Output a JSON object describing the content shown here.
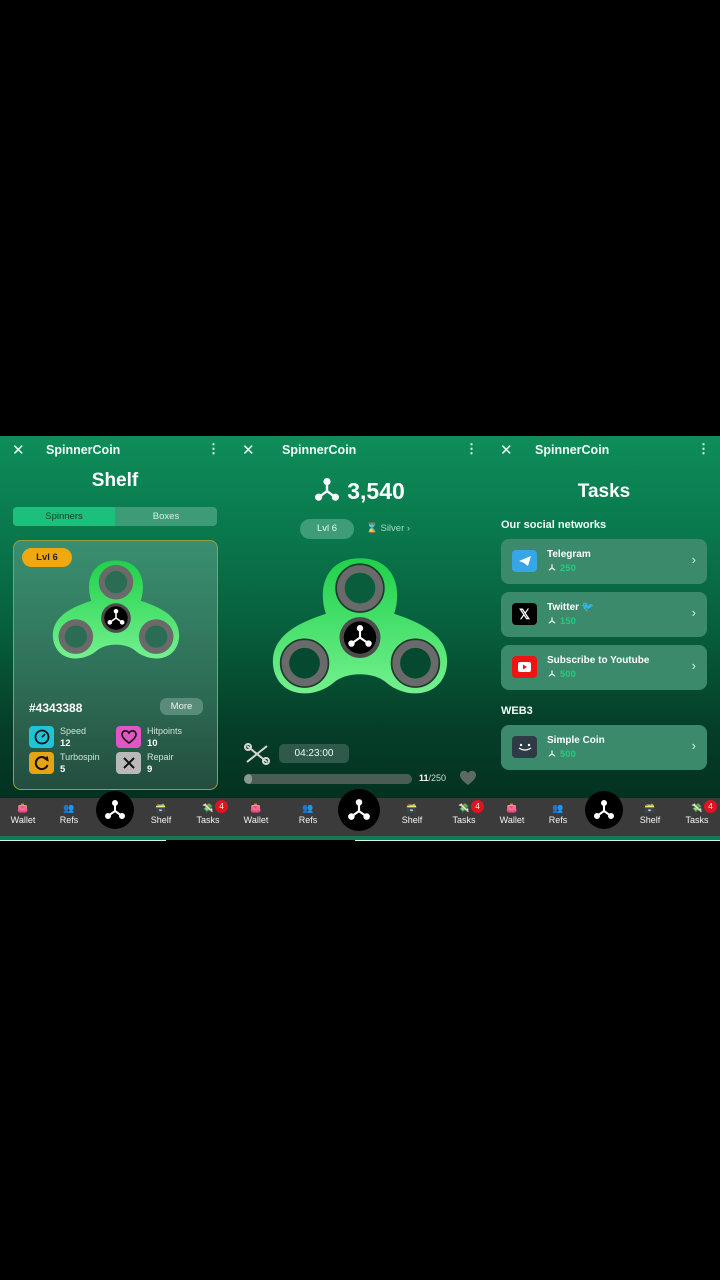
{
  "app": {
    "title": "SpinnerCoin",
    "close_icon": "close-icon",
    "menu_icon": "more-vertical-icon"
  },
  "shelf": {
    "title": "Shelf",
    "tabs": [
      {
        "label": "Spinners",
        "active": true
      },
      {
        "label": "Boxes",
        "active": false
      }
    ],
    "card": {
      "level": "Lvl 6",
      "id": "#4343388",
      "more_label": "More",
      "stats": [
        {
          "name": "Speed",
          "value": "12",
          "icon": "speedometer-icon",
          "color": "#1fc4d8"
        },
        {
          "name": "Hitpoints",
          "value": "10",
          "icon": "heart-icon",
          "color": "#e056c4"
        },
        {
          "name": "Turbospin",
          "value": "5",
          "icon": "refresh-icon",
          "color": "#e6a312"
        },
        {
          "name": "Repair",
          "value": "9",
          "icon": "tools-icon",
          "color": "#b9b9b9"
        }
      ]
    }
  },
  "home": {
    "balance": "3,540",
    "level": "Lvl 6",
    "league": "Silver",
    "league_chevron": "›",
    "repair_timer": "04:23:00",
    "hitpoints_current": "11",
    "hitpoints_max": "/250",
    "hitpoints_progress": 0.044
  },
  "tasks": {
    "title": "Tasks",
    "sections": [
      {
        "title": "Our social networks",
        "items": [
          {
            "name": "Telegram",
            "reward": "250",
            "icon": "telegram-icon"
          },
          {
            "name": "Twitter 🐦",
            "reward": "150",
            "icon": "x-twitter-icon"
          },
          {
            "name": "Subscribe to Youtube",
            "reward": "500",
            "icon": "youtube-icon"
          }
        ]
      },
      {
        "title": "WEB3",
        "items": [
          {
            "name": "Simple Coin",
            "reward": "500",
            "icon": "simple-coin-icon"
          }
        ]
      }
    ]
  },
  "nav": {
    "items": [
      {
        "label": "Wallet",
        "emoji": "👛"
      },
      {
        "label": "Refs",
        "emoji": "👥"
      },
      {
        "label": "Shelf",
        "emoji": "🗃️"
      },
      {
        "label": "Tasks",
        "emoji": "💸",
        "badge": "4"
      }
    ]
  },
  "colors": {
    "accent": "#1cbf7c",
    "header": "#0e8d5a",
    "badge": "#e0141e",
    "level_pill": "#f0a811"
  }
}
